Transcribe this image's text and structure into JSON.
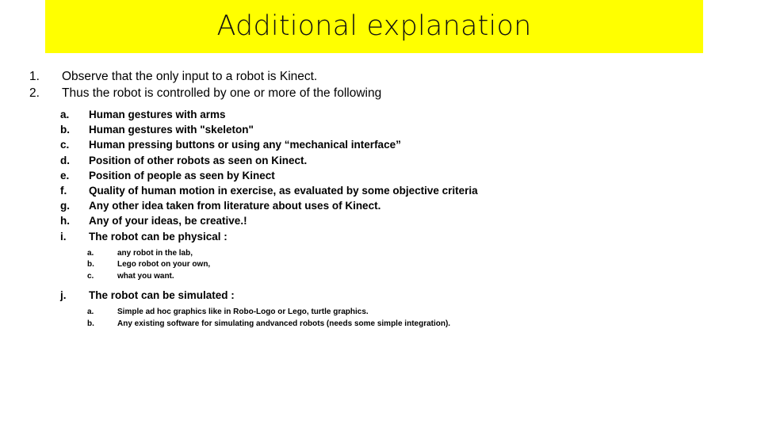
{
  "slide": {
    "title": "Additional explanation",
    "banner_color": "#FFFF00",
    "background_color": "#FFFFFF",
    "text_color": "#000000"
  },
  "outline": {
    "items": [
      {
        "marker": "1.",
        "text": "Observe that the only input to a robot is Kinect."
      },
      {
        "marker": "2.",
        "text": "Thus the robot is controlled by one or more of the following"
      }
    ],
    "sub_items": [
      {
        "marker": "a.",
        "text": "Human gestures with arms"
      },
      {
        "marker": "b.",
        "text": "Human gestures with \"skeleton\""
      },
      {
        "marker": "c.",
        "text": "Human pressing buttons or using any “mechanical interface”"
      },
      {
        "marker": "d.",
        "text": "Position of other robots as seen on Kinect."
      },
      {
        "marker": "e.",
        "text": "Position of people as seen by Kinect"
      },
      {
        "marker": "f.",
        "text": "Quality of human motion in exercise, as evaluated by some objective criteria"
      },
      {
        "marker": "g.",
        "text": "Any other idea taken from literature about uses of Kinect."
      },
      {
        "marker": "h.",
        "text": "Any of your ideas, be creative.!"
      },
      {
        "marker": "i.",
        "text": "The robot can be physical :"
      }
    ],
    "physical_options": [
      {
        "marker": "a.",
        "text": "any robot in the lab,"
      },
      {
        "marker": "b.",
        "text": "Lego robot on your own,"
      },
      {
        "marker": "c.",
        "text": "what you want."
      }
    ],
    "simulated_item": {
      "marker": "j.",
      "text": "The robot can be simulated :"
    },
    "simulated_options": [
      {
        "marker": "a.",
        "text": "Simple ad hoc graphics like in Robo-Logo or Lego, turtle graphics."
      },
      {
        "marker": "b.",
        "text": "Any existing software for simulating andvanced robots (needs some simple integration)."
      }
    ]
  }
}
